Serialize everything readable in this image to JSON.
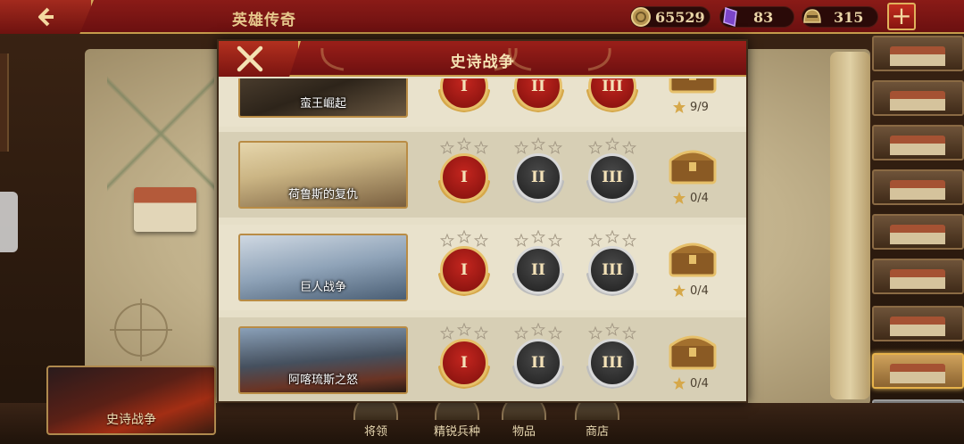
{
  "header": {
    "title": "英雄传奇",
    "resources": {
      "gold": "65529",
      "gems": "83",
      "food": "315"
    },
    "plus_label": "+"
  },
  "modal": {
    "title": "史诗战争",
    "chapters": [
      {
        "name": "蛮王崛起",
        "progress": "9/9",
        "difficulties": [
          "I",
          "II",
          "III"
        ],
        "active": [
          true,
          true,
          true
        ]
      },
      {
        "name": "荷鲁斯的复仇",
        "progress": "0/4",
        "difficulties": [
          "I",
          "II",
          "III"
        ],
        "active": [
          true,
          false,
          false
        ]
      },
      {
        "name": "巨人战争",
        "progress": "0/4",
        "difficulties": [
          "I",
          "II",
          "III"
        ],
        "active": [
          true,
          false,
          false
        ]
      },
      {
        "name": "阿喀琉斯之怒",
        "progress": "0/4",
        "difficulties": [
          "I",
          "II",
          "III"
        ],
        "active": [
          true,
          false,
          false
        ]
      }
    ]
  },
  "bottom": {
    "hero_card": "史诗战争",
    "buttons": [
      "将领",
      "精锐兵种",
      "物品",
      "商店"
    ]
  },
  "colors": {
    "header_red": "#8a1b17",
    "gold_trim": "#d5a85a",
    "medal_red": "#c4261f",
    "medal_grey": "#2e2e2e"
  }
}
